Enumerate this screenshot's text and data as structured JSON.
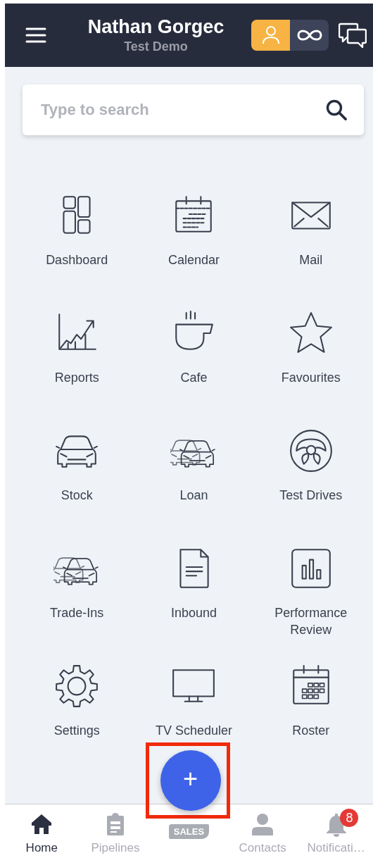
{
  "header": {
    "title": "Nathan Gorgec",
    "subtitle": "Test Demo",
    "mode_toggle": [
      {
        "kind": "person",
        "selected": true
      },
      {
        "kind": "infinity",
        "selected": false
      }
    ]
  },
  "search": {
    "placeholder": "Type to search"
  },
  "tiles": [
    {
      "kind": "dashboard",
      "label": "Dashboard"
    },
    {
      "kind": "calendar",
      "label": "Calendar"
    },
    {
      "kind": "mail",
      "label": "Mail"
    },
    {
      "kind": "reports",
      "label": "Reports"
    },
    {
      "kind": "cafe",
      "label": "Cafe"
    },
    {
      "kind": "favourites",
      "label": "Favourites"
    },
    {
      "kind": "car",
      "label": "Stock"
    },
    {
      "kind": "cars",
      "label": "Loan"
    },
    {
      "kind": "wheel",
      "label": "Test Drives"
    },
    {
      "kind": "cars",
      "label": "Trade-Ins"
    },
    {
      "kind": "document",
      "label": "Inbound"
    },
    {
      "kind": "performance",
      "label": "Performance Review"
    },
    {
      "kind": "settings",
      "label": "Settings"
    },
    {
      "kind": "tv",
      "label": "TV Scheduler"
    },
    {
      "kind": "roster",
      "label": "Roster"
    }
  ],
  "fab": {
    "label": "+",
    "highlighted": true
  },
  "bottom_nav": [
    {
      "kind": "home",
      "label": "Home",
      "selected": true
    },
    {
      "kind": "pipelines",
      "label": "Pipelines",
      "selected": false
    },
    {
      "kind": "sales",
      "tag": "SALES",
      "selected": false
    },
    {
      "kind": "contacts",
      "label": "Contacts",
      "selected": false
    },
    {
      "kind": "notifications",
      "label": "Notificati…",
      "badge": "8",
      "selected": false
    }
  ]
}
